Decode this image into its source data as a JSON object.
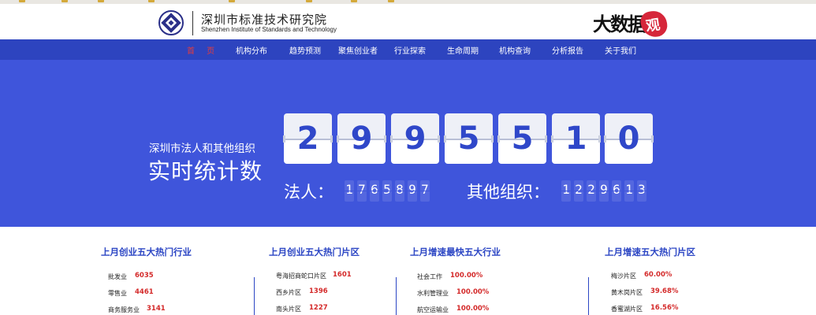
{
  "header": {
    "org_name_cn": "深圳市标准技术研究院",
    "org_name_en": "Shenzhen Institute of Standards and Technology",
    "brand_text": "大数据",
    "brand_seal": "观"
  },
  "nav": {
    "items": [
      "首 页",
      "机构分布",
      "趋势预测",
      "聚焦创业者",
      "行业探索",
      "生命周期",
      "机构查询",
      "分析报告",
      "关于我们"
    ]
  },
  "hero": {
    "subtitle": "深圳市法人和其他组织",
    "title": "实时统计数",
    "total_digits": [
      "2",
      "9",
      "9",
      "5",
      "5",
      "1",
      "0"
    ],
    "legal_label": "法人：",
    "legal_digits": [
      "1",
      "7",
      "6",
      "5",
      "8",
      "9",
      "7"
    ],
    "other_label": "其他组织：",
    "other_digits": [
      "1",
      "2",
      "2",
      "9",
      "6",
      "1",
      "3"
    ]
  },
  "rankings": [
    {
      "title": "上月创业五大热门行业",
      "rows": [
        {
          "name": "批发业",
          "value": "6035"
        },
        {
          "name": "零售业",
          "value": "4461"
        },
        {
          "name": "商务服务业",
          "value": "3141"
        }
      ]
    },
    {
      "title": "上月创业五大热门片区",
      "rows": [
        {
          "name": "粤海招商蛇口片区",
          "value": "1601"
        },
        {
          "name": "西乡片区",
          "value": "1396"
        },
        {
          "name": "南头片区",
          "value": "1227"
        }
      ]
    },
    {
      "title": "上月增速最快五大行业",
      "rows": [
        {
          "name": "社会工作",
          "value": "100.00%"
        },
        {
          "name": "水利管理业",
          "value": "100.00%"
        },
        {
          "name": "航空运输业",
          "value": "100.00%"
        }
      ]
    },
    {
      "title": "上月增速五大热门片区",
      "rows": [
        {
          "name": "梅沙片区",
          "value": "60.00%"
        },
        {
          "name": "黄木岗片区",
          "value": "39.68%"
        },
        {
          "name": "香蜜湖片区",
          "value": "16.56%"
        }
      ]
    }
  ],
  "colors": {
    "nav_bg": "#2d44bf",
    "hero_bg": "#3f55db",
    "accent_blue": "#2c46c4",
    "value_red": "#d42a2a",
    "nav_active": "#e83b3b"
  }
}
